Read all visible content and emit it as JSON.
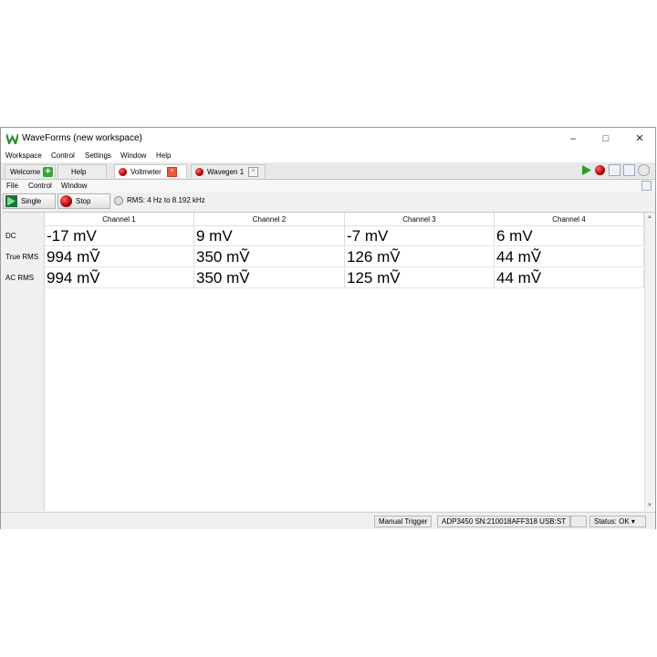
{
  "window": {
    "title": "WaveForms (new workspace)"
  },
  "menubar": [
    "Workspace",
    "Control",
    "Settings",
    "Window",
    "Help"
  ],
  "tabs": {
    "welcome": "Welcome",
    "help": "Help",
    "voltmeter": "Voltmeter",
    "wavegen": "Wavegen 1"
  },
  "submenu": [
    "File",
    "Control",
    "Window"
  ],
  "toolbar": {
    "single_label": "Single",
    "stop_label": "Stop",
    "rms_info": "RMS: 4 Hz to 8.192 kHz"
  },
  "table": {
    "columns": [
      "Channel 1",
      "Channel 2",
      "Channel 3",
      "Channel 4"
    ],
    "rows": [
      {
        "label": "DC",
        "values": [
          "-17 mV",
          "9 mV",
          "-7 mV",
          "6 mV"
        ]
      },
      {
        "label": "True RMS",
        "values": [
          "994 mṼ",
          "350 mṼ",
          "126 mṼ",
          "44 mṼ"
        ]
      },
      {
        "label": "AC RMS",
        "values": [
          "994 mṼ",
          "350 mṼ",
          "125 mṼ",
          "44 mṼ"
        ]
      }
    ]
  },
  "statusbar": {
    "trigger": "Manual Trigger",
    "device": "ADP3450 SN:210018AFF318 USB:ST",
    "status": "Status: OK"
  },
  "colors": {
    "accent_green": "#3aa33a",
    "stop_red": "#c00000"
  }
}
